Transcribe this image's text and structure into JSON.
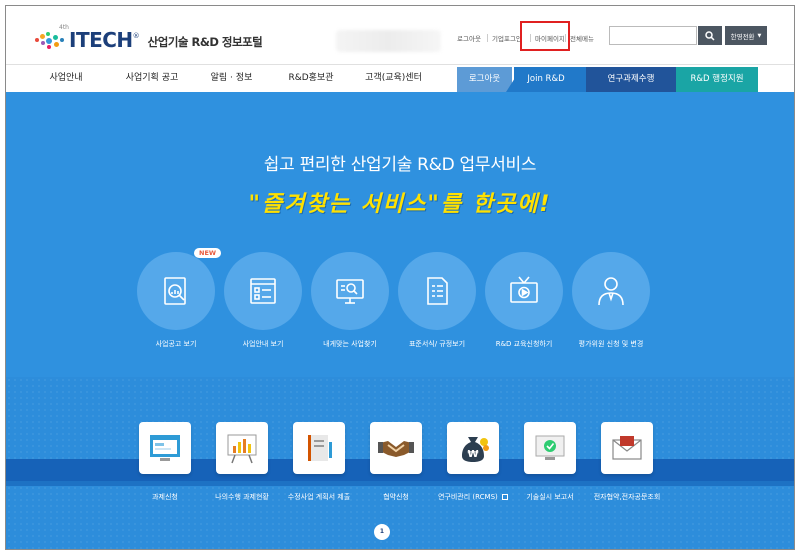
{
  "brand": {
    "logo_text": "ITECH",
    "logo_sup": "4th",
    "logo_trademark": "®",
    "subtitle": "산업기술 R&D 정보포털"
  },
  "utility": {
    "login": "로그아웃",
    "corp": "기업포그인",
    "mypage": "마이페이지",
    "sitemap": "전체메뉴",
    "language": "한영전환"
  },
  "search": {
    "placeholder": ""
  },
  "nav": {
    "items": [
      "사업안내",
      "사업기획 공고",
      "알림 · 정보",
      "R&D홍보관",
      "고객(교육)센터"
    ],
    "tabs": [
      "로그아웃",
      "Join R&D",
      "연구과제수행",
      "R&D 행정지원"
    ]
  },
  "hero": {
    "headline": "쉽고 편리한 산업기술 R&D 업무서비스",
    "subline": "\"즐겨찾는 서비스\"를 한곳에!",
    "new_badge": "NEW",
    "services": [
      {
        "label": "사업공고 보기",
        "icon": "search-document-icon"
      },
      {
        "label": "사업안내 보기",
        "icon": "checklist-icon"
      },
      {
        "label": "내게맞는 사업찾기",
        "icon": "monitor-search-icon"
      },
      {
        "label": "표준서식/ 규정보기",
        "icon": "form-document-icon"
      },
      {
        "label": "R&D 교육신청하기",
        "icon": "tv-play-icon"
      },
      {
        "label": "평가위원 신청 및 변경",
        "icon": "person-icon"
      }
    ],
    "quick": [
      {
        "label": "과제신청",
        "icon": "monitor-window-icon"
      },
      {
        "label": "나의수행 과제현황",
        "icon": "chart-board-icon"
      },
      {
        "label": "수정사업 계획서 제출",
        "icon": "book-icon"
      },
      {
        "label": "협약신청",
        "icon": "handshake-icon"
      },
      {
        "label": "연구비관리 (RCMS)",
        "icon": "money-bag-icon"
      },
      {
        "label": "기술실시 보고서",
        "icon": "monitor-report-icon"
      },
      {
        "label": "전자협약,전자공문조회",
        "icon": "envelope-icon"
      }
    ],
    "pager": "1"
  },
  "colors": {
    "hero_bg": "#2f91df",
    "nav_tab_join": "#2179c9",
    "nav_tab_research": "#21549a",
    "nav_tab_admin": "#1aa5a5",
    "highlight_box": "#e02020",
    "subline": "#ffe100"
  }
}
